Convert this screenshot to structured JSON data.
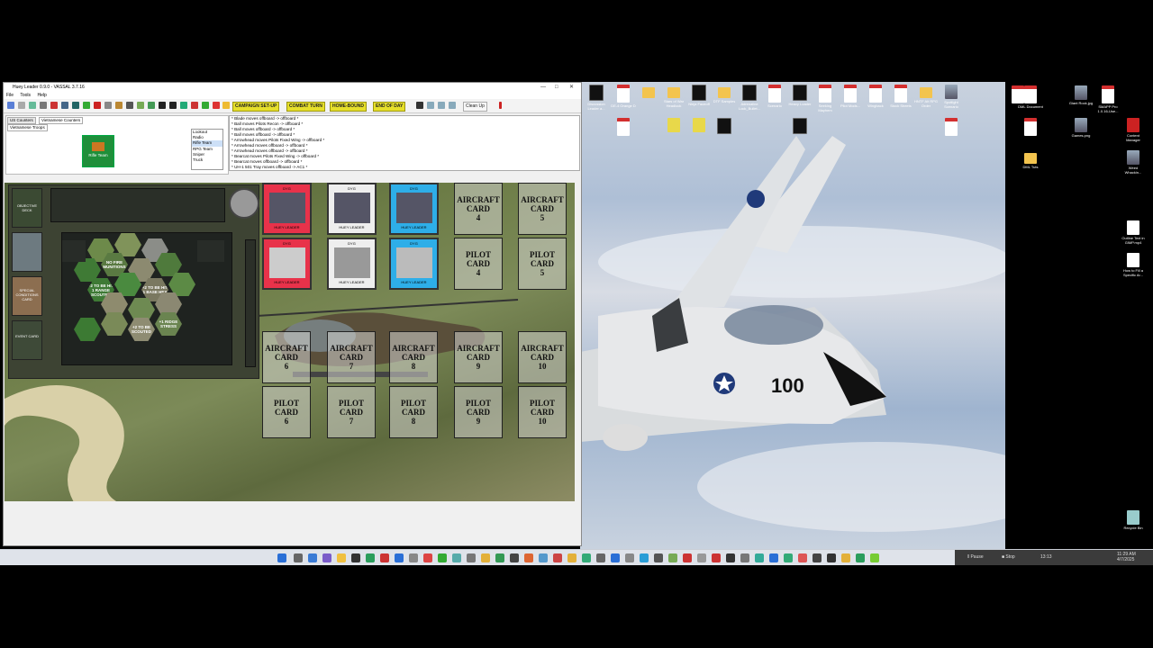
{
  "window": {
    "title": "Huey Leader 0.9.0 - VASSAL 3.7.16",
    "menu": [
      "File",
      "Tools",
      "Help"
    ]
  },
  "toolbar": {
    "buttons": [
      "CAMPAIGN SET-UP",
      "COMBAT TURN",
      "HOME-BOUND",
      "END OF DAY"
    ],
    "clean_up": "Clean Up"
  },
  "palette": {
    "tabs": [
      "US Counters",
      "Vietnamese Counters"
    ],
    "subtab": "Vietnamese Troops",
    "piece_label": "Rifle Team",
    "list": [
      "Lookout",
      "Radio",
      "Rifle Team",
      "RPG Team",
      "Sniper",
      "Truck"
    ],
    "selected": "Rifle Team"
  },
  "chat": {
    "lines": [
      "* Blade moves offboard -> offboard *",
      "* Ball moves Pilots Recon -> offboard *",
      "* Ball moves offboard -> offboard *",
      "* Ball moves offboard -> offboard *",
      "* Arrowhead moves Pilots Fixed Wing -> offboard *",
      "* Arrowhead moves offboard -> offboard *",
      "* Arrowhead moves offboard -> offboard *",
      "* Bearcat moves Pilots Fixed Wing -> offboard *",
      "* Bearcat moves offboard -> offboard *",
      "* UH-1 501 Tray moves offboard -> AC1 *",
      "* UH-1 501 Tray moves AC1 -> offboard *"
    ]
  },
  "board": {
    "side_cards": [
      "OBJECTIVE DECK",
      "SPECIAL CONDITIONS CARD",
      "EVENT CARD"
    ],
    "hexes": [
      "NO FIRE MUNITIONS",
      "+2 TO BE HIT 1 RANGE SCOUTED",
      "+2 TO BE HIT 1 BASE HEX",
      "+2 TO BE SCOUTED",
      "+1 RIDGE STRESS"
    ]
  },
  "cards": {
    "aircraft_top": [
      {
        "l": "AIRCRAFT CARD",
        "n": "4"
      },
      {
        "l": "AIRCRAFT CARD",
        "n": "5"
      }
    ],
    "pilot_top": [
      {
        "l": "PILOT CARD",
        "n": "4"
      },
      {
        "l": "PILOT CARD",
        "n": "5"
      }
    ],
    "aircraft_bottom": [
      {
        "l": "AIRCRAFT CARD",
        "n": "6"
      },
      {
        "l": "AIRCRAFT CARD",
        "n": "7"
      },
      {
        "l": "AIRCRAFT CARD",
        "n": "8"
      },
      {
        "l": "AIRCRAFT CARD",
        "n": "9"
      },
      {
        "l": "AIRCRAFT CARD",
        "n": "10"
      }
    ],
    "pilot_bottom": [
      {
        "l": "PILOT CARD",
        "n": "6"
      },
      {
        "l": "PILOT CARD",
        "n": "7"
      },
      {
        "l": "PILOT CARD",
        "n": "8"
      },
      {
        "l": "PILOT CARD",
        "n": "9"
      },
      {
        "l": "PILOT CARD",
        "n": "10"
      }
    ],
    "placed": [
      {
        "top": "DYG",
        "bottom": "HUEY LEADER",
        "color": "#e8324a"
      },
      {
        "top": "DYG",
        "bottom": "HUEY LEADER",
        "color": "#eeeeee"
      },
      {
        "top": "DYG",
        "bottom": "HUEY LEADER",
        "color": "#2eaee8"
      }
    ]
  },
  "desktop": {
    "icons": [
      "Discussion Leader a...",
      "DE-4 Orange D",
      "",
      "Stars of War Headlock",
      "Ninja Faceoff",
      "DTF Samples",
      "Adrenaline Lock_Bullet...",
      "Scenario",
      "Heavy Loader",
      "Seeking Mayhem",
      "Pilot Mods...",
      "Wingback",
      "Stock Sheets",
      "HNTF Alt RPG Order",
      "Spotlight Scenario",
      "Giant Rock.jpg",
      "SMAPP Pro 1.0.16-Use...",
      "DML Document",
      "Games.png",
      "DML Tuts",
      "Content Manager",
      "Weed Whackin...",
      "Outline Text in GIMP.mp4",
      "How to Fill a Specific Ar...",
      "Recycle Bin"
    ]
  },
  "taskbar": {
    "pause": "Pause",
    "stop": "Stop",
    "time_counter": "13:13",
    "clock": "11:29 AM 4/7/2025"
  }
}
